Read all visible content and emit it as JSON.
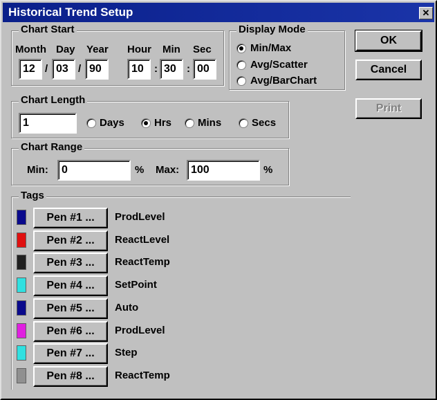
{
  "window": {
    "title": "Historical Trend Setup",
    "close_glyph": "✕"
  },
  "chart_start": {
    "title": "Chart Start",
    "labels": {
      "month": "Month",
      "day": "Day",
      "year": "Year",
      "hour": "Hour",
      "min": "Min",
      "sec": "Sec"
    },
    "values": {
      "month": "12",
      "day": "03",
      "year": "90",
      "hour": "10",
      "min": "30",
      "sec": "00"
    },
    "separators": {
      "date": "/",
      "time": ":"
    }
  },
  "display_mode": {
    "title": "Display Mode",
    "options": [
      "Min/Max",
      "Avg/Scatter",
      "Avg/BarChart"
    ],
    "selected": "Min/Max"
  },
  "buttons": {
    "ok": "OK",
    "cancel": "Cancel",
    "print": "Print"
  },
  "chart_length": {
    "title": "Chart Length",
    "value": "1",
    "units": [
      "Days",
      "Hrs",
      "Mins",
      "Secs"
    ],
    "selected": "Hrs"
  },
  "chart_range": {
    "title": "Chart Range",
    "min_label": "Min:",
    "min_value": "0",
    "max_label": "Max:",
    "max_value": "100",
    "unit": "%"
  },
  "tags": {
    "title": "Tags",
    "pens": [
      {
        "label": "Pen #1 ...",
        "tag": "ProdLevel",
        "color": "#0a0a8c"
      },
      {
        "label": "Pen #2 ...",
        "tag": "ReactLevel",
        "color": "#e01010"
      },
      {
        "label": "Pen #3 ...",
        "tag": "ReactTemp",
        "color": "#202020"
      },
      {
        "label": "Pen #4 ...",
        "tag": "SetPoint",
        "color": "#30e0e0"
      },
      {
        "label": "Pen #5 ...",
        "tag": "Auto",
        "color": "#0a0a8c"
      },
      {
        "label": "Pen #6 ...",
        "tag": "ProdLevel",
        "color": "#e020e0"
      },
      {
        "label": "Pen #7 ...",
        "tag": "Step",
        "color": "#30e0e0"
      },
      {
        "label": "Pen #8 ...",
        "tag": "ReactTemp",
        "color": "#909090"
      }
    ]
  }
}
